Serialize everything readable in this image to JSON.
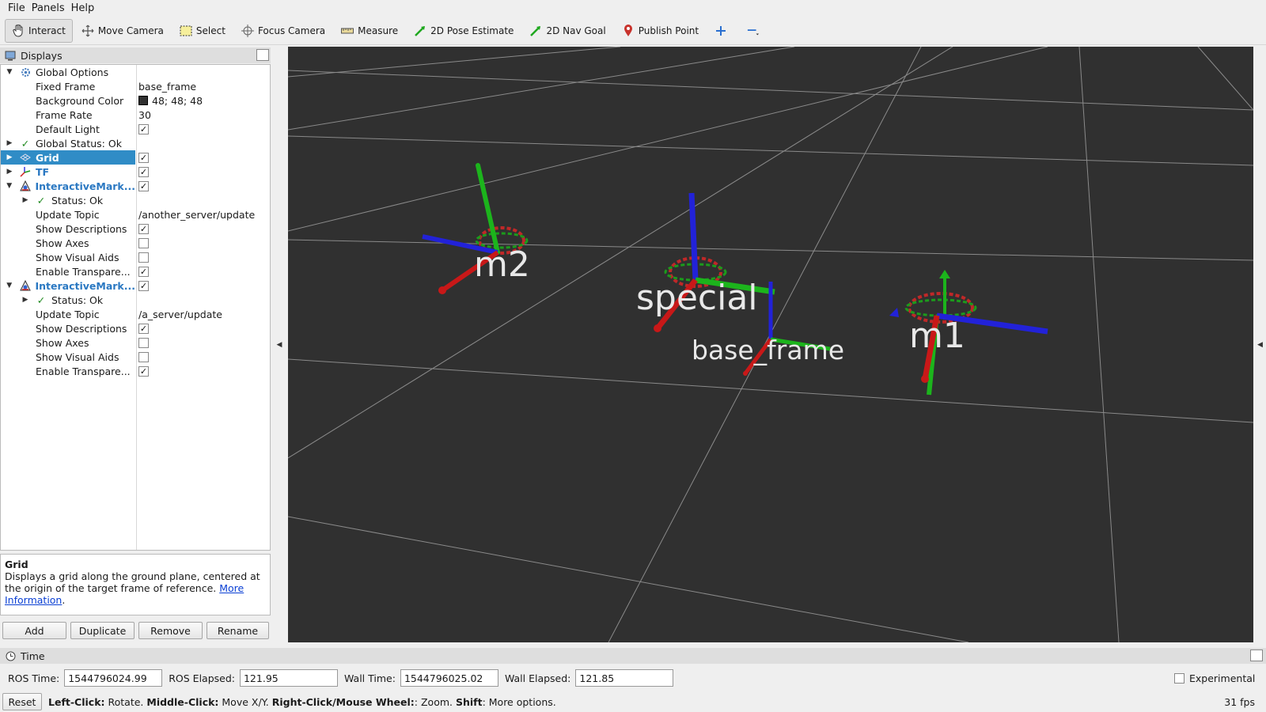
{
  "menu": [
    "File",
    "Panels",
    "Help"
  ],
  "toolbar": {
    "interact": "Interact",
    "move_camera": "Move Camera",
    "select": "Select",
    "focus_camera": "Focus Camera",
    "measure": "Measure",
    "pose_estimate": "2D Pose Estimate",
    "nav_goal": "2D Nav Goal",
    "publish_point": "Publish Point"
  },
  "displays": {
    "title": "Displays",
    "global_options": "Global Options",
    "fixed_frame_label": "Fixed Frame",
    "fixed_frame_value": "base_frame",
    "background_color_label": "Background Color",
    "background_color_value": "48; 48; 48",
    "frame_rate_label": "Frame Rate",
    "frame_rate_value": "30",
    "default_light_label": "Default Light",
    "global_status": "Global Status: Ok",
    "grid": "Grid",
    "tf": "TF",
    "im1_name": "InteractiveMark...",
    "im1_status": "Status: Ok",
    "im1_topic_label": "Update Topic",
    "im1_topic_value": "/another_server/update",
    "show_descriptions": "Show Descriptions",
    "show_axes": "Show Axes",
    "show_visual_aids": "Show Visual Aids",
    "enable_transparency": "Enable Transpare...",
    "im2_name": "InteractiveMark...",
    "im2_status": "Status: Ok",
    "im2_topic_label": "Update Topic",
    "im2_topic_value": "/a_server/update"
  },
  "description": {
    "title": "Grid",
    "text": "Displays a grid along the ground plane, centered at the origin of the target frame of reference. ",
    "link": "More Information",
    "end": "."
  },
  "buttons": {
    "add": "Add",
    "duplicate": "Duplicate",
    "remove": "Remove",
    "rename": "Rename"
  },
  "view": {
    "labels": [
      "m2",
      "special",
      "base_frame",
      "m1"
    ]
  },
  "time": {
    "title": "Time",
    "ros_time_label": "ROS Time:",
    "ros_time": "1544796024.99",
    "ros_elapsed_label": "ROS Elapsed:",
    "ros_elapsed": "121.95",
    "wall_time_label": "Wall Time:",
    "wall_time": "1544796025.02",
    "wall_elapsed_label": "Wall Elapsed:",
    "wall_elapsed": "121.85",
    "experimental": "Experimental"
  },
  "status": {
    "reset": "Reset",
    "left_click": "Left-Click:",
    "rotate": " Rotate. ",
    "middle_click": "Middle-Click:",
    "move": " Move X/Y. ",
    "right_click": "Right-Click/Mouse Wheel:",
    "zoom": ": Zoom. ",
    "shift": "Shift",
    "more": ": More options.",
    "fps": "31 fps"
  },
  "colors": {
    "view_bg": "#303030",
    "selected": "#308cc6",
    "link": "#0a3fd4"
  }
}
